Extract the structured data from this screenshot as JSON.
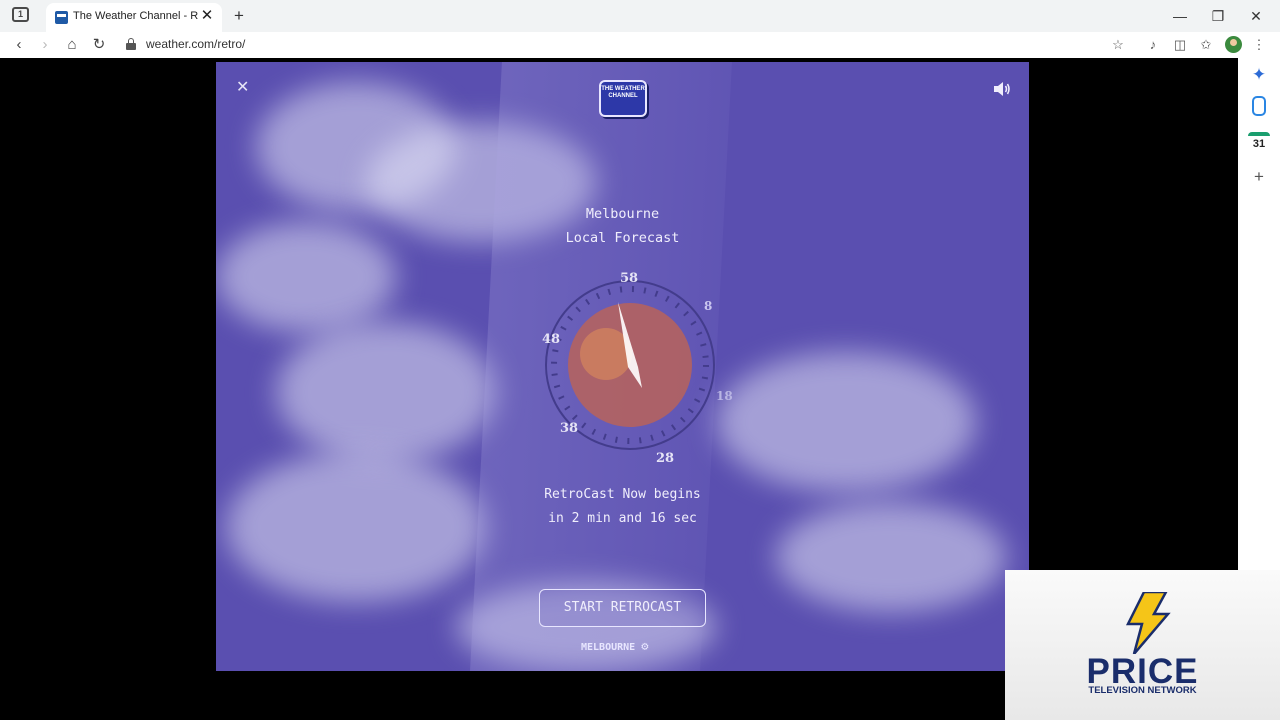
{
  "browser": {
    "tab_title": "The Weather Channel - Ret",
    "tab_count_badge": "1",
    "url": "weather.com/retro/",
    "new_tab_label": "+",
    "sidebar_calendar_date": "31"
  },
  "app": {
    "logo_text": "THE WEATHER CHANNEL",
    "city": "Melbourne",
    "forecast_title": "Local Forecast",
    "gauge_ticks": [
      "58",
      "8",
      "18",
      "28",
      "38",
      "48"
    ],
    "countdown_line1": "RetroCast Now begins",
    "countdown_line2": "in 2 min and 16 sec",
    "start_button_label": "START RETROCAST",
    "location_label": "MELBOURNE"
  },
  "watermark": {
    "title": "PRICE",
    "subtitle": "Television Network"
  },
  "colors": {
    "sky": "#5a4fb0",
    "logo_blue": "#2d38a8",
    "globe": "#b8635a",
    "watermark_navy": "#1a2d6b",
    "bolt_yellow": "#f5c518"
  }
}
